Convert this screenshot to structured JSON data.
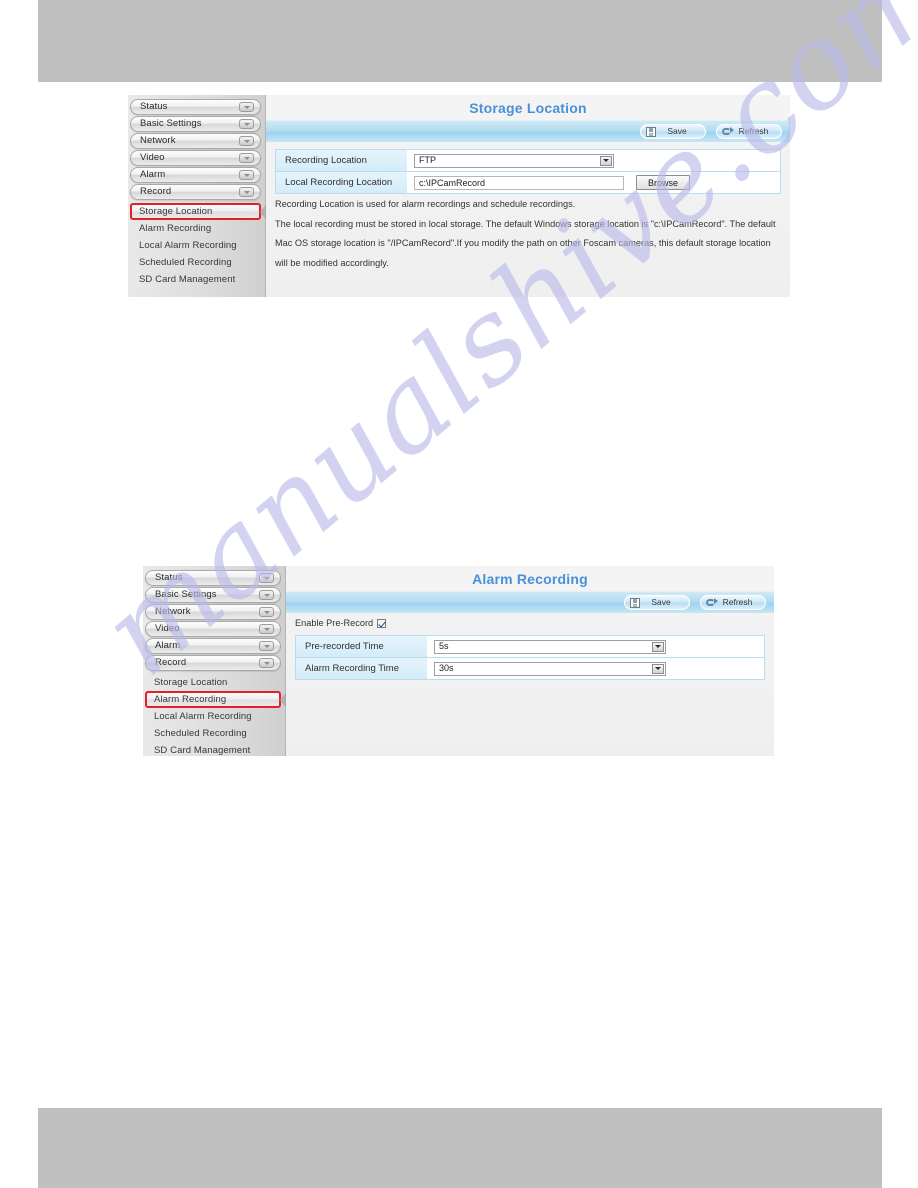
{
  "watermark": {
    "text": "manualshive.com"
  },
  "screenshots": [
    {
      "id": "storage-location",
      "title": "Storage Location",
      "toolbar": {
        "save_label": "Save",
        "refresh_label": "Refresh"
      },
      "sidebar": {
        "top_items": [
          {
            "label": "Status"
          },
          {
            "label": "Basic Settings"
          },
          {
            "label": "Network"
          },
          {
            "label": "Video"
          },
          {
            "label": "Alarm"
          },
          {
            "label": "Record"
          }
        ],
        "sub_items": [
          {
            "label": "Storage Location",
            "active": true
          },
          {
            "label": "Alarm Recording",
            "active": false
          },
          {
            "label": "Local Alarm Recording",
            "active": false
          },
          {
            "label": "Scheduled Recording",
            "active": false
          },
          {
            "label": "SD Card Management",
            "active": false
          }
        ]
      },
      "rows": [
        {
          "label": "Recording Location",
          "type": "select",
          "value": "FTP"
        },
        {
          "label": "Local Recording Location",
          "type": "text",
          "value": "c:\\IPCamRecord",
          "button": "Browse"
        }
      ],
      "notes": [
        "Recording Location is used for alarm recordings and schedule recordings.",
        "The local recording must be stored in local storage. The default Windows storage location is \"c:\\IPCamRecord\". The default",
        "Mac OS storage location is \"/IPCamRecord\".If you modify the path on other Foscam cameras, this default storage location",
        "will be modified accordingly."
      ]
    },
    {
      "id": "alarm-recording",
      "title": "Alarm Recording",
      "toolbar": {
        "save_label": "Save",
        "refresh_label": "Refresh"
      },
      "sidebar": {
        "top_items": [
          {
            "label": "Status"
          },
          {
            "label": "Basic Settings"
          },
          {
            "label": "Network"
          },
          {
            "label": "Video"
          },
          {
            "label": "Alarm"
          },
          {
            "label": "Record"
          }
        ],
        "sub_items": [
          {
            "label": "Storage Location",
            "active": false
          },
          {
            "label": "Alarm Recording",
            "active": true
          },
          {
            "label": "Local Alarm Recording",
            "active": false
          },
          {
            "label": "Scheduled Recording",
            "active": false
          },
          {
            "label": "SD Card Management",
            "active": false
          }
        ]
      },
      "checkbox": {
        "label": "Enable Pre-Record",
        "checked": true
      },
      "rows": [
        {
          "label": "Pre-recorded Time",
          "type": "select",
          "value": "5s"
        },
        {
          "label": "Alarm Recording Time",
          "type": "select",
          "value": "30s"
        }
      ]
    }
  ],
  "colors": {
    "title_blue": "#4a90d9",
    "toolbar_blue": "#9ed3ee",
    "highlight_red": "#e22027",
    "band_gray": "#c0c0c0",
    "label_cell": "#d4ecf9",
    "watermark": "#b9b9ea"
  }
}
